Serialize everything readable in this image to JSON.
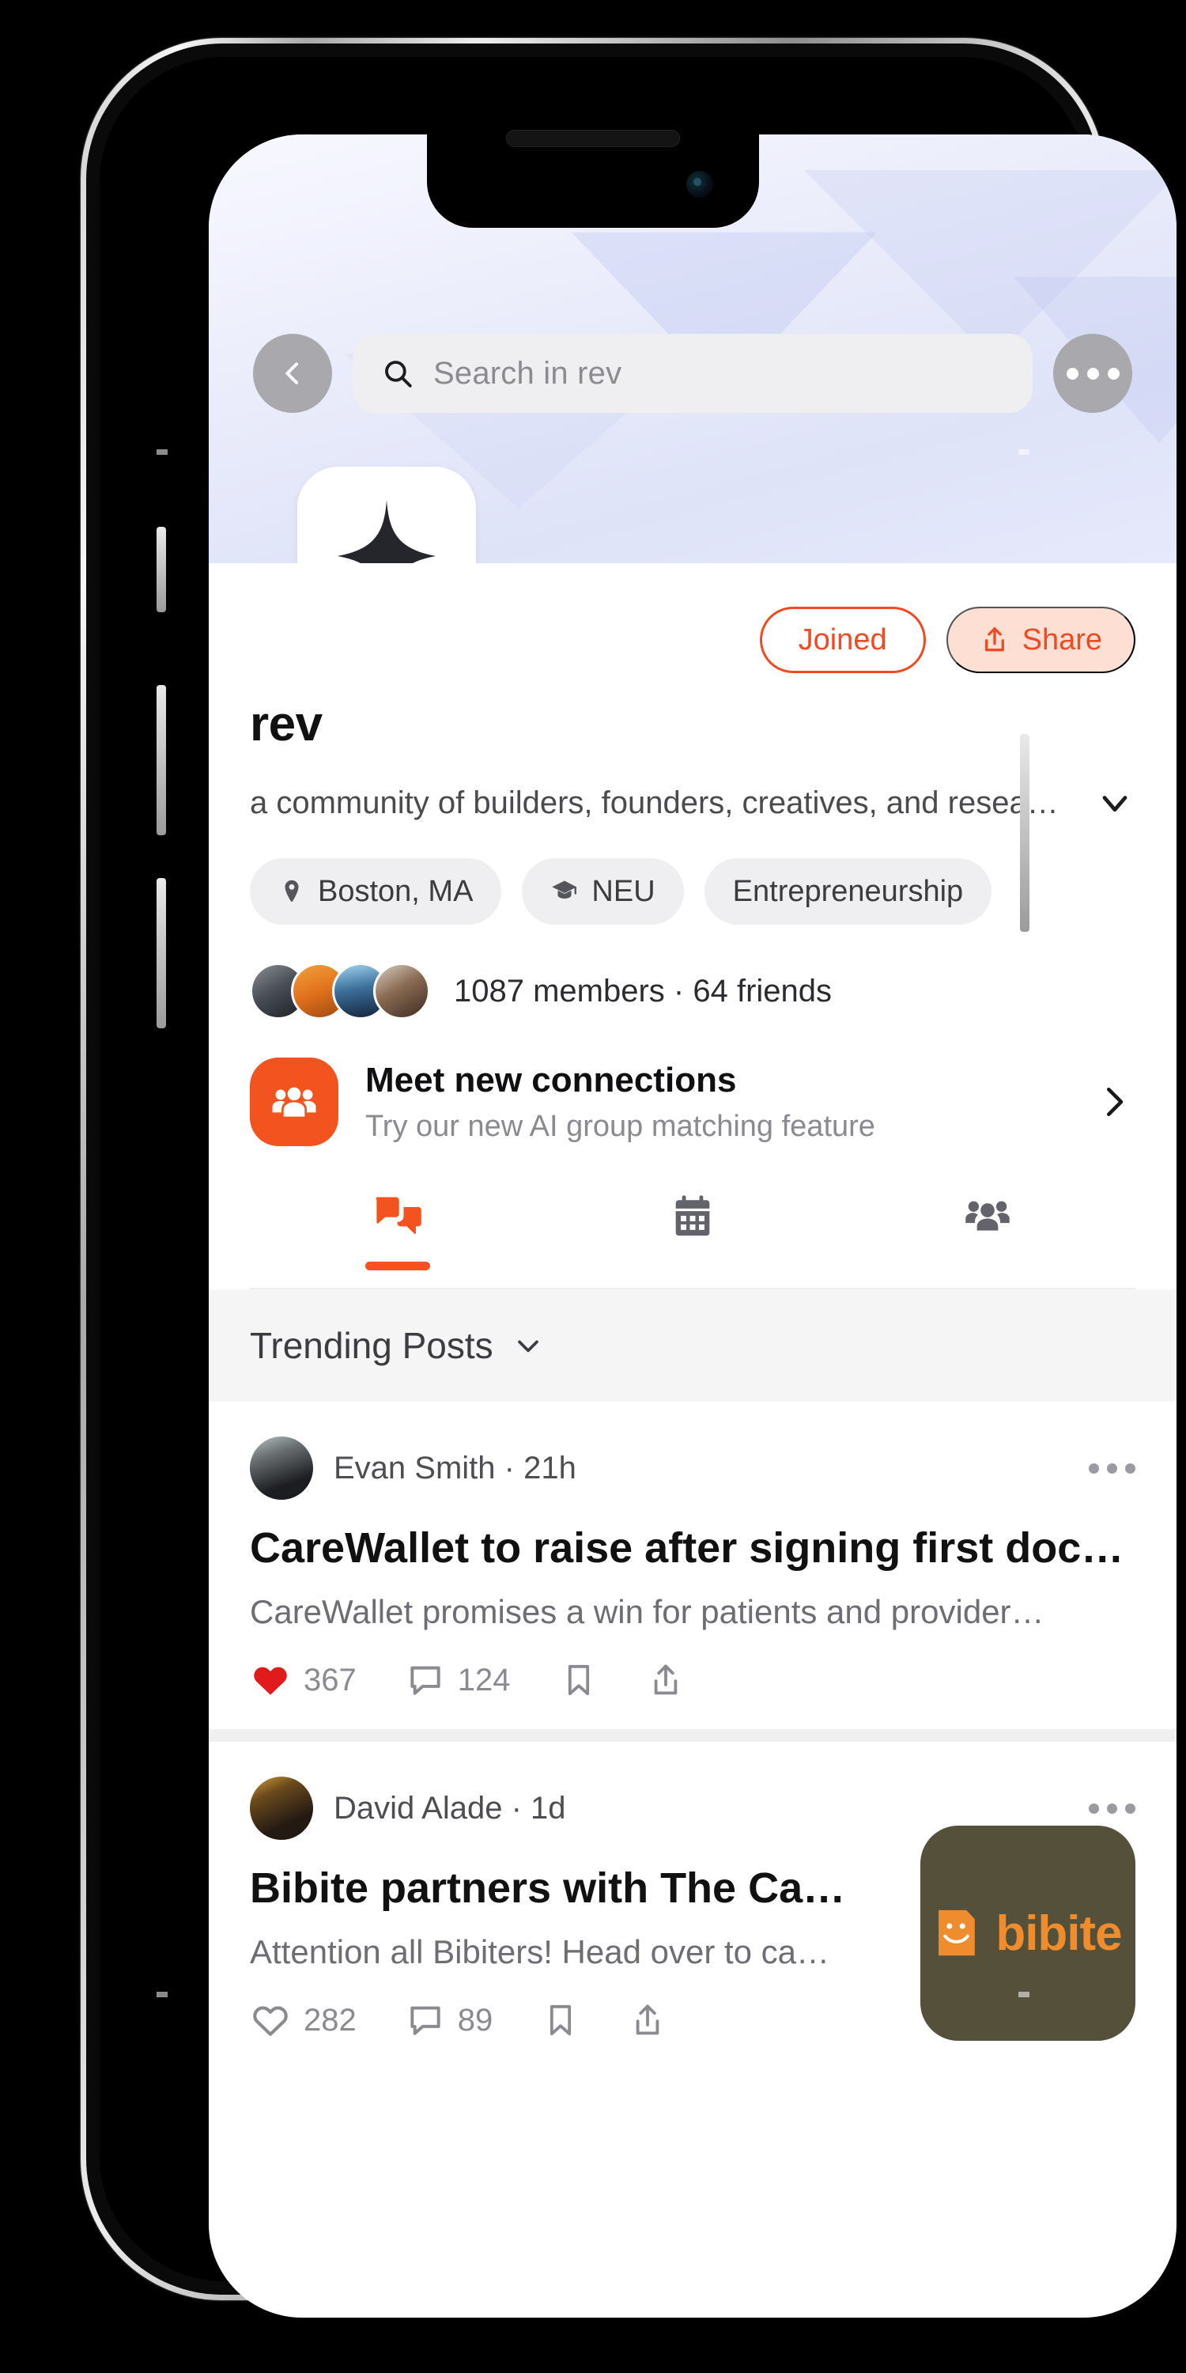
{
  "theme": {
    "accent": "#f2531f",
    "accent_alt": "#ef4a23",
    "share_bg": "#fde0d3",
    "like_red": "#e11b1b",
    "banner_start": "#f7f8ff",
    "banner_end": "#dfe3f8",
    "thumb_bg": "#55503a",
    "thumb_fg": "#ef8c2e"
  },
  "topbar": {
    "back_icon": "chevron-left-icon",
    "more_icon": "ellipsis-icon",
    "search_placeholder": "Search in rev",
    "search_value": "",
    "search_icon": "search-icon"
  },
  "profile": {
    "logo_icon": "four-point-star-icon",
    "name": "rev",
    "description": "a community of builders, founders, creatives, and resea…",
    "expand_icon": "chevron-down-icon",
    "joined_label": "Joined",
    "share_label": "Share",
    "share_icon": "share-upload-icon",
    "tags": [
      {
        "label": "Boston, MA",
        "icon": "location-pin-icon"
      },
      {
        "label": "NEU",
        "icon": "graduation-cap-icon"
      },
      {
        "label": "Entrepreneurship",
        "icon": ""
      }
    ],
    "members_text": "1087 members · 64 friends",
    "avatar_count": 4
  },
  "connect_card": {
    "icon": "people-group-icon",
    "title": "Meet new connections",
    "subtitle": "Try our new AI group matching feature",
    "chevron": "chevron-right-icon"
  },
  "tabs": [
    {
      "name": "posts",
      "icon": "chat-bubbles-icon",
      "active": true
    },
    {
      "name": "events",
      "icon": "calendar-icon",
      "active": false
    },
    {
      "name": "members",
      "icon": "people-group-icon",
      "active": false
    }
  ],
  "feed": {
    "section_label": "Trending Posts",
    "section_icon": "chevron-down-icon",
    "posts": [
      {
        "author": "Evan Smith",
        "time": "21h",
        "meta": "Evan Smith · 21h",
        "title": "CareWallet to raise after signing first doctors",
        "body": "CareWallet promises a win for patients and provider…",
        "liked": true,
        "likes": "367",
        "comments": "124",
        "bookmark_icon": "bookmark-icon",
        "share_icon": "share-upload-icon",
        "more_icon": "ellipsis-icon",
        "thumbnail": null
      },
      {
        "author": "David Alade",
        "time": "1d",
        "meta": "David Alade · 1d",
        "title": "Bibite partners with The Capital…",
        "body": "Attention all Bibiters! Head over to ca…",
        "liked": false,
        "likes": "282",
        "comments": "89",
        "bookmark_icon": "bookmark-icon",
        "share_icon": "share-upload-icon",
        "more_icon": "ellipsis-icon",
        "thumbnail": {
          "label": "bibite",
          "icon": "bibite-mascot-icon"
        }
      }
    ]
  }
}
